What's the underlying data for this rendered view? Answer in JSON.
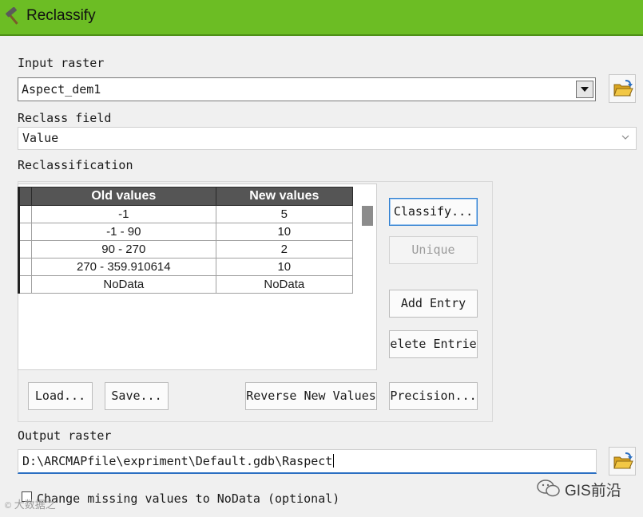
{
  "window": {
    "title": "Reclassify"
  },
  "input_raster": {
    "label": "Input raster",
    "value": "Aspect_dem1"
  },
  "reclass_field": {
    "label": "Reclass field",
    "value": "Value"
  },
  "reclassification": {
    "label": "Reclassification",
    "columns": [
      "Old values",
      "New values"
    ],
    "rows": [
      [
        "-1",
        "5"
      ],
      [
        "-1 - 90",
        "10"
      ],
      [
        "90 - 270",
        "2"
      ],
      [
        "270 - 359.910614",
        "10"
      ],
      [
        "NoData",
        "NoData"
      ]
    ],
    "buttons": {
      "classify": "Classify...",
      "unique": "Unique",
      "add_entry": "Add Entry",
      "delete_entries": "elete Entrie",
      "load": "Load...",
      "save": "Save...",
      "reverse": "Reverse New Values",
      "precision": "Precision..."
    }
  },
  "output_raster": {
    "label": "Output raster",
    "value": "D:\\ARCMAPfile\\expriment\\Default.gdb\\Raspect"
  },
  "missing_values": {
    "label": "Change missing values to NoData (optional)",
    "checked": false
  },
  "watermark": {
    "brand": "GIS前沿",
    "overlay": "大数据之"
  },
  "colors": {
    "titlebar": "#6cbd24",
    "accent": "#2f7fd1"
  },
  "icons": {
    "title": "hammer-icon",
    "browse": "folder-open-icon"
  }
}
